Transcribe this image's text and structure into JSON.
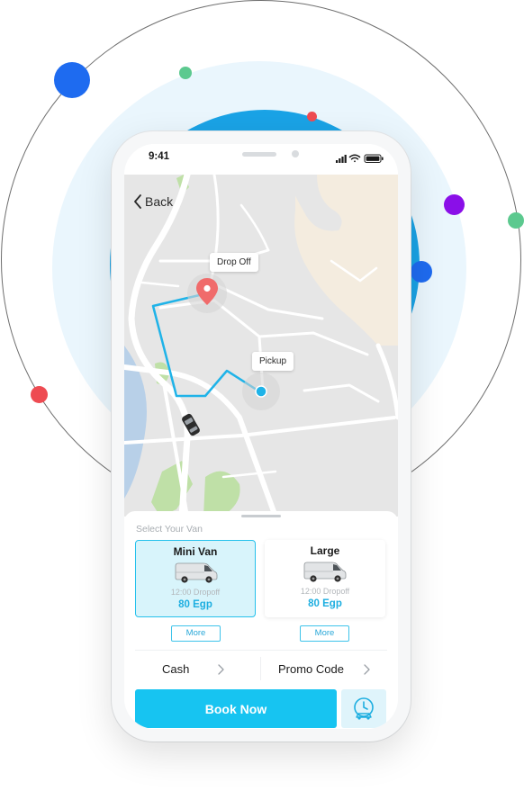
{
  "status_bar": {
    "time": "9:41"
  },
  "navigation": {
    "back_label": "Back"
  },
  "map": {
    "dropoff_label": "Drop Off",
    "pickup_label": "Pickup"
  },
  "sheet": {
    "title": "Select Your Van",
    "vans": [
      {
        "name": "Mini Van",
        "eta": "12:00 Dropoff",
        "price": "80 Egp",
        "selected": true,
        "more_label": "More"
      },
      {
        "name": "Large",
        "eta": "12:00 Dropoff",
        "price": "80 Egp",
        "selected": false,
        "more_label": "More"
      }
    ],
    "payment_label": "Cash",
    "promo_label": "Promo Code",
    "book_label": "Book Now"
  },
  "icons": {
    "back": "chevron-left-icon",
    "signal": "signal-icon",
    "wifi": "wifi-icon",
    "battery": "battery-icon",
    "dropoff": "map-pin-icon",
    "pickup": "location-dot-icon",
    "car": "car-icon",
    "van": "van-icon",
    "chevron": "chevron-right-icon",
    "schedule": "clock-vehicle-icon"
  },
  "colors": {
    "accent": "#17c4f1",
    "route": "#1fb3e8",
    "pin": "#f06b6b",
    "selected_bg": "#d8f4fb",
    "price": "#1daee0"
  }
}
